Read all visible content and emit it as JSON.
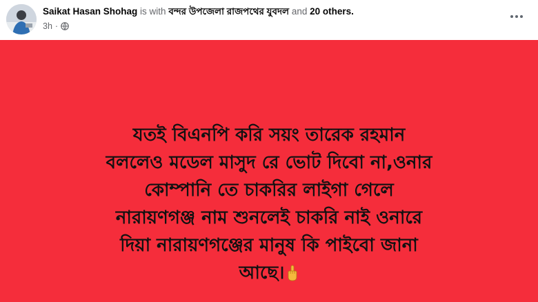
{
  "post": {
    "author": "Saikat Hasan Shohag",
    "with_text": " is with ",
    "group": "বন্দর উপজেলা রাজপথের যুবদল",
    "and_text": " and ",
    "others": "20 others.",
    "time": "3h",
    "dot": "·",
    "privacy_icon": "globe-icon",
    "more_icon": "more-options-icon"
  },
  "status": {
    "background": "#f52d3b",
    "lines": [
      "যতই বিএনপি করি সয়ং তারেক রহমান",
      "বললেও মডেল মাসুদ রে ভোট দিবো না,ওনার",
      "কোম্পানি তে চাকরির লাইগা গেলে",
      "নারায়ণগঞ্জ নাম শুনলেই চাকরি নাই ওনারে",
      "দিয়া নারায়ণগঞ্জের মানুষ কি পাইবো জানা",
      "আছে।"
    ],
    "end_emoji": "pointing-finger-emoji"
  }
}
